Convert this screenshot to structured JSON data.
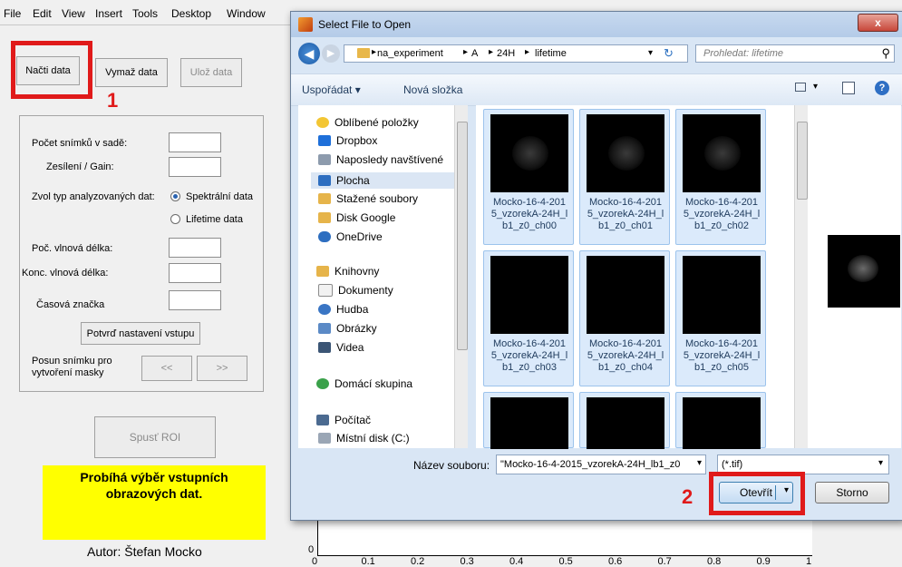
{
  "menubar": {
    "items": [
      "File",
      "Edit",
      "View",
      "Insert",
      "Tools",
      "Desktop",
      "Window"
    ]
  },
  "matlab": {
    "btn_load": "Načti data",
    "btn_clear": "Vymaž data",
    "btn_save": "Ulož data",
    "label_count": "Počet snímků v sadě:",
    "label_gain": "Zesílení / Gain:",
    "label_type": "Zvol typ analyzovaných dat:",
    "radio_spectral": "Spektrální data",
    "radio_lifetime": "Lifetime data",
    "label_start_wl": "Poč. vlnová délka:",
    "label_end_wl": "Konc. vlnová délka:",
    "label_timestamp": "Časová značka",
    "btn_confirm": "Potvrď nastavení vstupu",
    "label_shift": "Posun snímku pro vytvoření masky",
    "btn_prev": "<<",
    "btn_next": ">>",
    "btn_roi": "Spusť ROI",
    "status": "Probíhá výběr vstupních obrazových dat.",
    "author": "Autor: Štefan Mocko",
    "marker1": "1",
    "marker2": "2",
    "status_color": "#ffff00"
  },
  "plot": {
    "ytick": "0",
    "xticks": [
      "0",
      "0.1",
      "0.2",
      "0.3",
      "0.4",
      "0.5",
      "0.6",
      "0.7",
      "0.8",
      "0.9",
      "1"
    ]
  },
  "dialog": {
    "title": "Select File to Open",
    "close": "x",
    "breadcrumb": [
      "na_experiment",
      "A",
      "24H",
      "lifetime"
    ],
    "search_placeholder": "Prohledat: lifetime",
    "organize": "Uspořádat ▾",
    "new_folder": "Nová složka",
    "nav": {
      "favorites": "Oblíbené položky",
      "dropbox": "Dropbox",
      "recent": "Naposledy navštívené",
      "desktop": "Plocha",
      "downloads": "Stažené soubory",
      "gdrive": "Disk Google",
      "onedrive": "OneDrive",
      "libraries": "Knihovny",
      "documents": "Dokumenty",
      "music": "Hudba",
      "pictures": "Obrázky",
      "videos": "Videa",
      "homegroup": "Domácí skupina",
      "computer": "Počítač",
      "local_disk": "Místní disk (C:)"
    },
    "files": [
      {
        "name": "Mocko-16-4-2015_vzorekA-24H_lb1_z0_ch00",
        "line1": "Mocko-16-4-201",
        "line2": "5_vzorekA-24H_l",
        "line3": "b1_z0_ch00"
      },
      {
        "name": "Mocko-16-4-2015_vzorekA-24H_lb1_z0_ch01",
        "line1": "Mocko-16-4-201",
        "line2": "5_vzorekA-24H_l",
        "line3": "b1_z0_ch01"
      },
      {
        "name": "Mocko-16-4-2015_vzorekA-24H_lb1_z0_ch02",
        "line1": "Mocko-16-4-201",
        "line2": "5_vzorekA-24H_l",
        "line3": "b1_z0_ch02"
      },
      {
        "name": "Mocko-16-4-2015_vzorekA-24H_lb1_z0_ch03",
        "line1": "Mocko-16-4-201",
        "line2": "5_vzorekA-24H_l",
        "line3": "b1_z0_ch03"
      },
      {
        "name": "Mocko-16-4-2015_vzorekA-24H_lb1_z0_ch04",
        "line1": "Mocko-16-4-201",
        "line2": "5_vzorekA-24H_l",
        "line3": "b1_z0_ch04"
      },
      {
        "name": "Mocko-16-4-2015_vzorekA-24H_lb1_z0_ch05",
        "line1": "Mocko-16-4-201",
        "line2": "5_vzorekA-24H_l",
        "line3": "b1_z0_ch05"
      }
    ],
    "filename_label": "Název souboru:",
    "filename_value": "\"Mocko-16-4-2015_vzorekA-24H_lb1_z0",
    "filter_value": "(*.tif)",
    "open": "Otevřít",
    "cancel": "Storno"
  }
}
